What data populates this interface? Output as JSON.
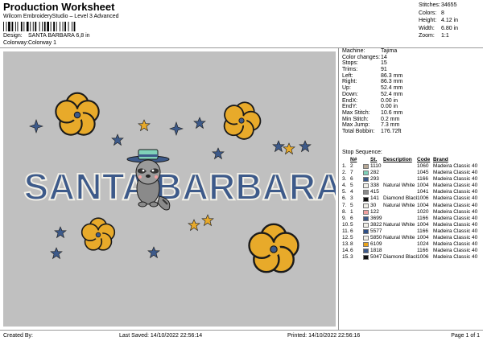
{
  "header": {
    "title": "Production Worksheet",
    "subtitle": "Wilcom EmbroideryStudio – Level 3 Advanced",
    "design_label": "Design:",
    "design_value": "SANTA BARBARA 6,8 in",
    "colorway_label": "Colorway:",
    "colorway_value": "Colorway 1"
  },
  "stats": [
    {
      "k": "Stitches:",
      "v": "34655"
    },
    {
      "k": "Colors:",
      "v": "8"
    },
    {
      "k": "Height:",
      "v": "4.12 in"
    },
    {
      "k": "Width:",
      "v": "6.80 in"
    },
    {
      "k": "Zoom:",
      "v": "1:1"
    }
  ],
  "design_text": {
    "left": "SANTA",
    "right": "BARBARA"
  },
  "info": [
    {
      "k": "Machine:",
      "v": "Tajima"
    },
    {
      "k": "Color changes:",
      "v": "14"
    },
    {
      "k": "Stops:",
      "v": "15"
    },
    {
      "k": "Trims:",
      "v": "91"
    },
    {
      "k": "Left:",
      "v": "86.3 mm"
    },
    {
      "k": "Right:",
      "v": "86.3 mm"
    },
    {
      "k": "Up:",
      "v": "52.4 mm"
    },
    {
      "k": "Down:",
      "v": "52.4 mm"
    },
    {
      "k": "EndX:",
      "v": "0.00 in"
    },
    {
      "k": "EndY:",
      "v": "0.00 in"
    },
    {
      "k": "Max Stitch:",
      "v": "10.6 mm"
    },
    {
      "k": "Min Stitch:",
      "v": "0.2 mm"
    },
    {
      "k": "Max Jump:",
      "v": "7.3 mm"
    },
    {
      "k": "Total Bobbin:",
      "v": "176.72ft"
    }
  ],
  "sequence": {
    "title": "Stop Sequence:",
    "headers": {
      "n": "N#",
      "st": "St.",
      "desc": "Description",
      "code": "Code",
      "brand": "Brand"
    },
    "rows": [
      {
        "stop": "1.",
        "n": "2",
        "color": "#b7a897",
        "code": "1110",
        "desc": "",
        "code2": "1060",
        "brand": "Madeira Classic 40"
      },
      {
        "stop": "2.",
        "n": "7",
        "color": "#7fd1b9",
        "code": "282",
        "desc": "",
        "code2": "1045",
        "brand": "Madeira Classic 40"
      },
      {
        "stop": "3.",
        "n": "6",
        "color": "#3d5a8a",
        "code": "293",
        "desc": "",
        "code2": "1166",
        "brand": "Madeira Classic 40"
      },
      {
        "stop": "4.",
        "n": "5",
        "color": "#f2f0e8",
        "code": "338",
        "desc": "Natural White",
        "code2": "1004",
        "brand": "Madeira Classic 40"
      },
      {
        "stop": "5.",
        "n": "4",
        "color": "#8a8a8a",
        "code": "415",
        "desc": "",
        "code2": "1041",
        "brand": "Madeira Classic 40"
      },
      {
        "stop": "6.",
        "n": "3",
        "color": "#111111",
        "code": "141",
        "desc": "Diamond Black",
        "code2": "1006",
        "brand": "Madeira Classic 40"
      },
      {
        "stop": "7.",
        "n": "5",
        "color": "#f2f0e8",
        "code": "30",
        "desc": "Natural White",
        "code2": "1004",
        "brand": "Madeira Classic 40"
      },
      {
        "stop": "8.",
        "n": "1",
        "color": "#f0a0a0",
        "code": "122",
        "desc": "",
        "code2": "1020",
        "brand": "Madeira Classic 40"
      },
      {
        "stop": "9.",
        "n": "6",
        "color": "#3d5a8a",
        "code": "3699",
        "desc": "",
        "code2": "1166",
        "brand": "Madeira Classic 40"
      },
      {
        "stop": "10.",
        "n": "5",
        "color": "#f2f0e8",
        "code": "3822",
        "desc": "Natural White",
        "code2": "1004",
        "brand": "Madeira Classic 40"
      },
      {
        "stop": "11.",
        "n": "6",
        "color": "#2f4f86",
        "code": "5577",
        "desc": "",
        "code2": "1166",
        "brand": "Madeira Classic 40"
      },
      {
        "stop": "12.",
        "n": "5",
        "color": "#f2f0e8",
        "code": "5850",
        "desc": "Natural White",
        "code2": "1004",
        "brand": "Madeira Classic 40"
      },
      {
        "stop": "13.",
        "n": "8",
        "color": "#e8a21a",
        "code": "6109",
        "desc": "",
        "code2": "1024",
        "brand": "Madeira Classic 40"
      },
      {
        "stop": "14.",
        "n": "6",
        "color": "#3d5a8a",
        "code": "1818",
        "desc": "",
        "code2": "1166",
        "brand": "Madeira Classic 40"
      },
      {
        "stop": "15.",
        "n": "3",
        "color": "#111111",
        "code": "5047",
        "desc": "Diamond Black",
        "code2": "1006",
        "brand": "Madeira Classic 40"
      }
    ]
  },
  "footer": {
    "created": "Created By:",
    "saved": "Last Saved: 14/10/2022 22:56:14",
    "printed": "Printed: 14/10/2022 22:56:16",
    "page": "Page 1 of 1"
  }
}
